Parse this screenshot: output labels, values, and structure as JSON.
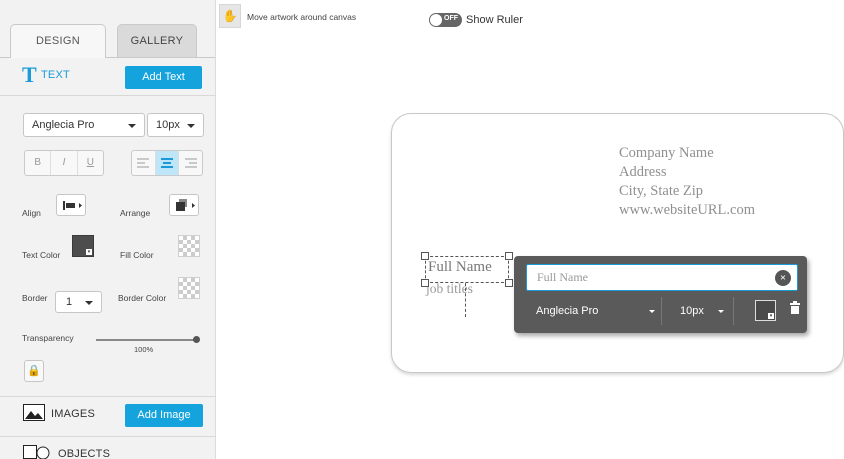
{
  "sidebar": {
    "tabs": {
      "design": "DESIGN",
      "gallery": "GALLERY"
    },
    "text_section": {
      "icon_letter": "T",
      "label": "TEXT",
      "add_button": "Add Text"
    },
    "font": {
      "family": "Anglecia Pro",
      "size": "10px"
    },
    "style_buttons": [
      "B",
      "I",
      "U"
    ],
    "labels": {
      "align": "Align",
      "arrange": "Arrange",
      "text_color": "Text Color",
      "fill_color": "Fill Color",
      "border": "Border",
      "border_color": "Border Color",
      "transparency": "Transparency"
    },
    "border_value": "1",
    "transparency_value": "100%",
    "images_section": {
      "label": "IMAGES",
      "add_button": "Add Image"
    },
    "objects_section": {
      "label": "OBJECTS"
    }
  },
  "top_bar": {
    "move_text": "Move artwork around canvas",
    "toggle_state": "OFF",
    "ruler_label": "Show Ruler"
  },
  "card": {
    "company": "Company Name",
    "address": "Address",
    "city": "City, State Zip",
    "website": "www.websiteURL.com",
    "full_name": "Full Name",
    "job_title": "job titles"
  },
  "editor": {
    "input_placeholder": "Full Name",
    "font": "Anglecia Pro",
    "size": "10px"
  },
  "colors": {
    "accent": "#14a3dc",
    "popup_bg": "#5a5a5a",
    "card_text": "#8f8f8f"
  }
}
